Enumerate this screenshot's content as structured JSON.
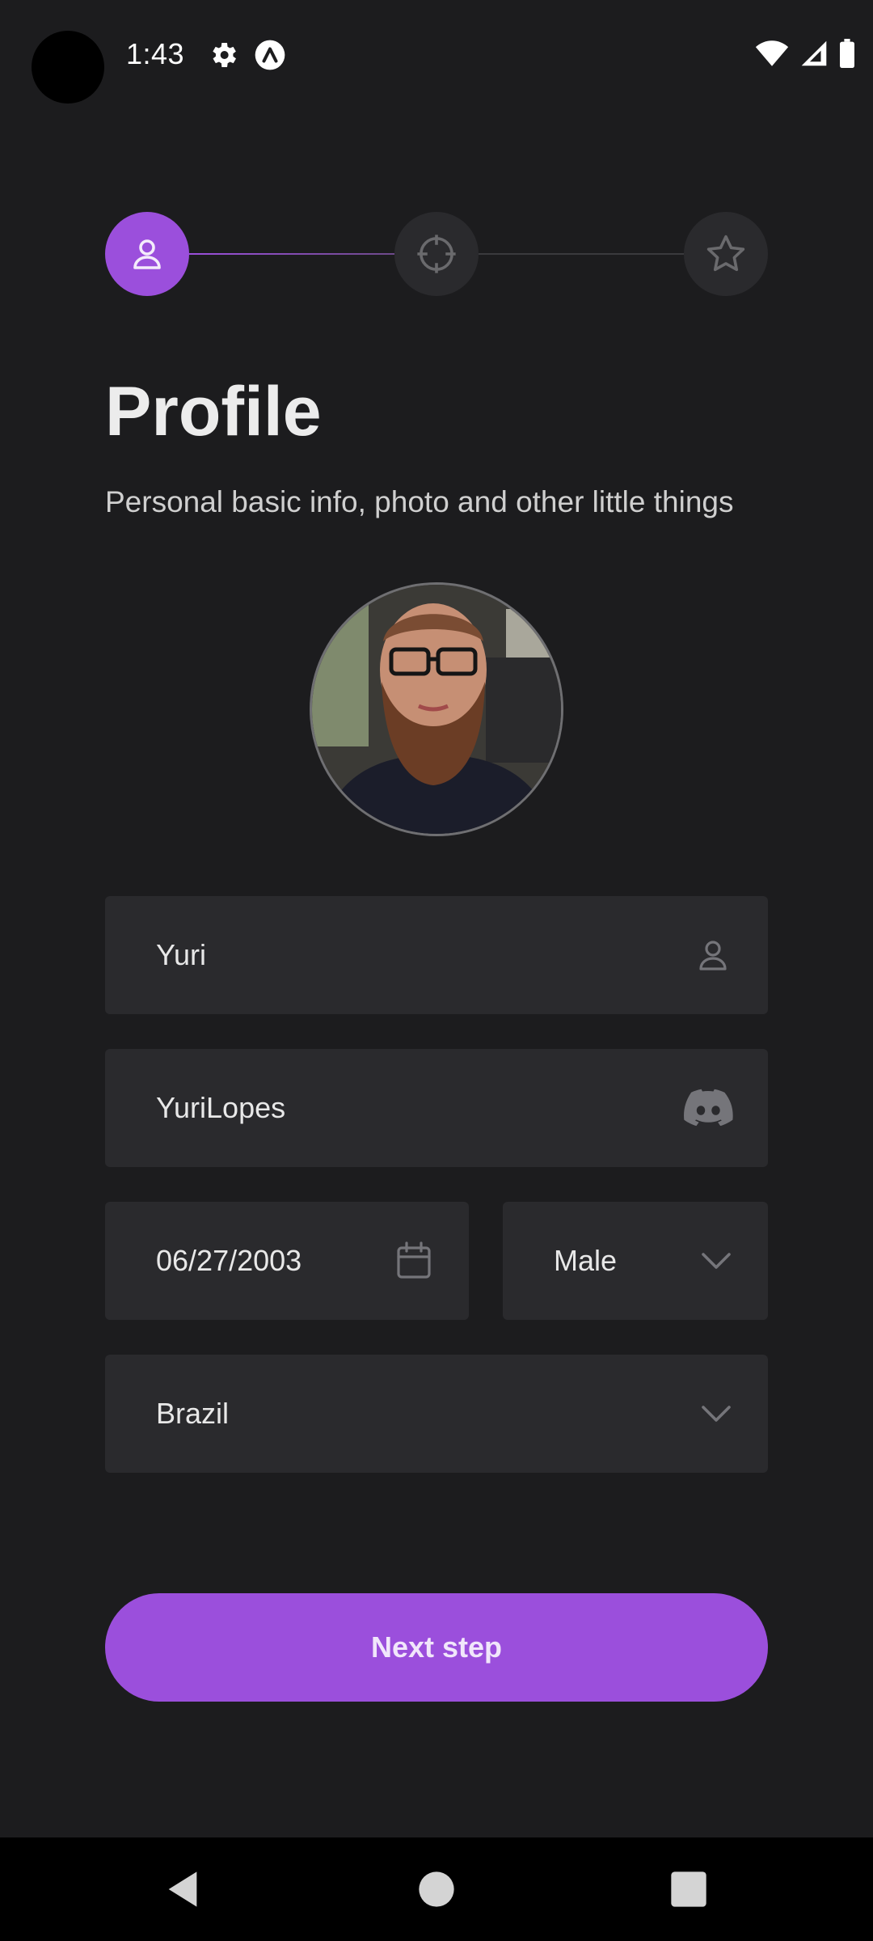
{
  "status_bar": {
    "time": "1:43"
  },
  "stepper": {
    "steps": [
      {
        "icon": "user-icon",
        "state": "active"
      },
      {
        "icon": "crosshair-icon",
        "state": "idle"
      },
      {
        "icon": "star-icon",
        "state": "idle"
      }
    ],
    "accent_color": "#9b4fdc"
  },
  "header": {
    "title": "Profile",
    "subtitle": "Personal basic info, photo and other little things"
  },
  "form": {
    "name": {
      "value": "Yuri",
      "icon": "user-icon"
    },
    "discord": {
      "value": "YuriLopes",
      "icon": "discord-icon"
    },
    "birthdate": {
      "value": "06/27/2003",
      "icon": "calendar-icon"
    },
    "gender": {
      "value": "Male",
      "icon": "chevron-down-icon"
    },
    "country": {
      "value": "Brazil",
      "icon": "chevron-down-icon"
    }
  },
  "actions": {
    "next_label": "Next step"
  }
}
